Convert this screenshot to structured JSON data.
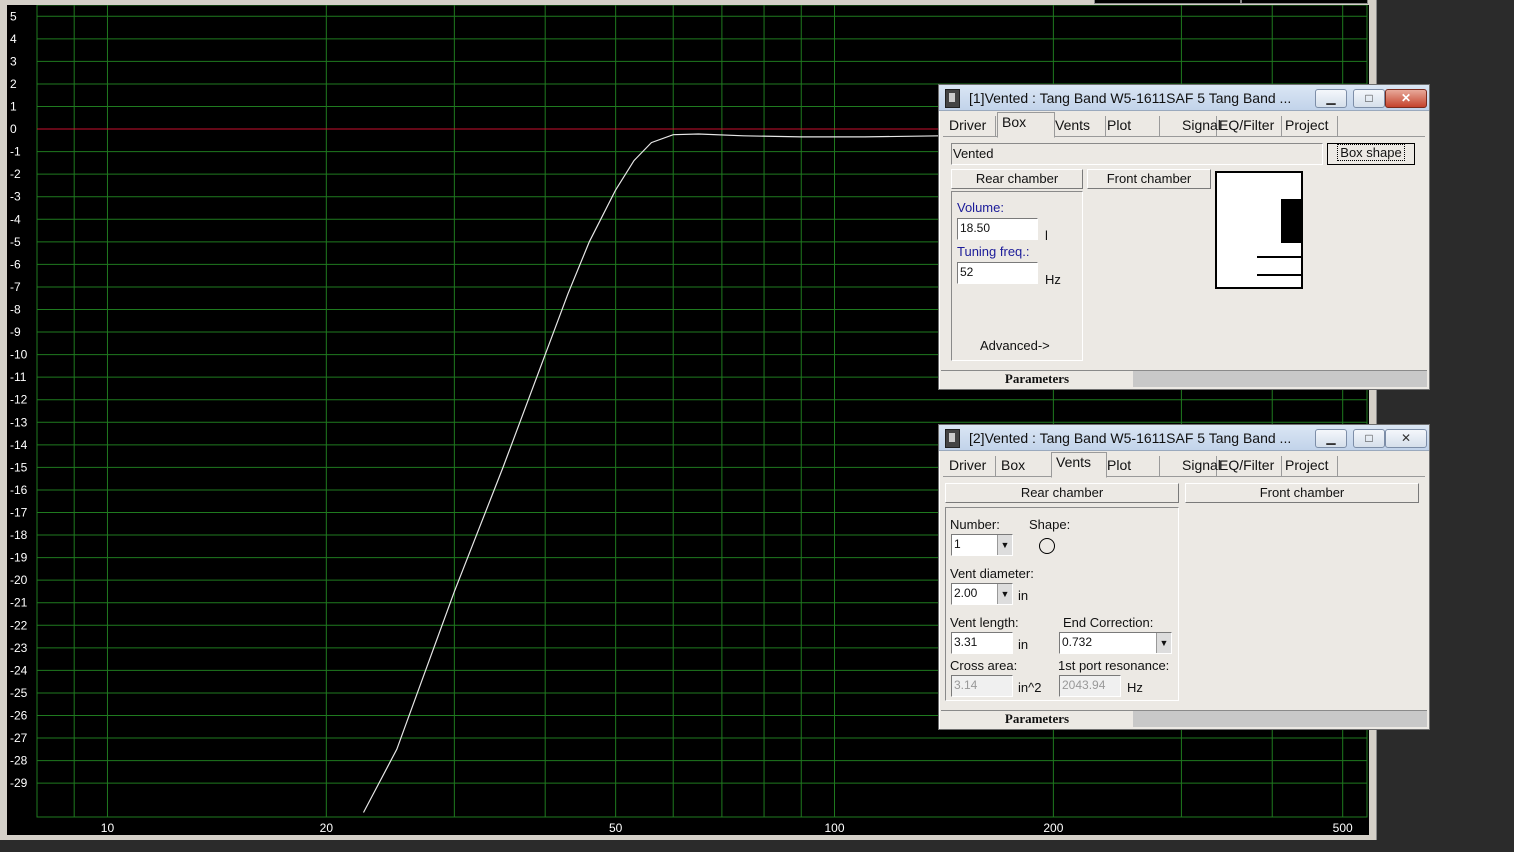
{
  "graph": {
    "chart_data": {
      "type": "line",
      "x_scale": "log",
      "xlim": [
        8,
        540
      ],
      "ylim": [
        -30.5,
        5.5
      ],
      "x_ticks": [
        10,
        20,
        50,
        100,
        200,
        500
      ],
      "x_tick_labels": [
        "10",
        "20",
        "50",
        "100",
        "200",
        "500"
      ],
      "y_ticks": [
        5,
        4,
        3,
        2,
        1,
        0,
        -1,
        -2,
        -3,
        -4,
        -5,
        -6,
        -7,
        -8,
        -9,
        -10,
        -11,
        -12,
        -13,
        -14,
        -15,
        -16,
        -17,
        -18,
        -19,
        -20,
        -21,
        -22,
        -23,
        -24,
        -25,
        -26,
        -27,
        -28,
        -29
      ],
      "grid": true,
      "reference_line_y": 0,
      "series": [
        {
          "color": "#e6e6e6",
          "x": [
            22.5,
            25,
            30,
            35,
            40,
            43,
            46,
            50,
            53,
            56,
            60,
            65,
            75,
            90,
            110,
            140,
            160
          ],
          "y": [
            -30.3,
            -27.5,
            -20.5,
            -15.0,
            -10.0,
            -7.3,
            -5.0,
            -2.7,
            -1.4,
            -0.6,
            -0.25,
            -0.22,
            -0.3,
            -0.35,
            -0.35,
            -0.3,
            -0.3
          ]
        }
      ],
      "colors": {
        "background": "#000000",
        "grid": "#1f7a1f",
        "reference": "#c8102e",
        "text": "#ffffff"
      }
    }
  },
  "win1": {
    "title": "[1]Vented : Tang Band W5-1611SAF 5 Tang Band ...",
    "tabs": [
      "Driver",
      "Box",
      "Vents",
      "Plot",
      "Signal",
      "EQ/Filter",
      "Project"
    ],
    "active_tab": "Box",
    "box_type": "Vented",
    "box_shape_button": "Box shape",
    "rear_chamber_button": "Rear chamber",
    "front_chamber_button": "Front chamber",
    "volume_label": "Volume:",
    "volume_value": "18.50",
    "volume_unit": "l",
    "tuning_label": "Tuning freq.:",
    "tuning_value": "52",
    "tuning_unit": "Hz",
    "advanced_button": "Advanced->",
    "status": "Parameters"
  },
  "win2": {
    "title": "[2]Vented : Tang Band W5-1611SAF 5 Tang Band ...",
    "tabs": [
      "Driver",
      "Box",
      "Vents",
      "Plot",
      "Signal",
      "EQ/Filter",
      "Project"
    ],
    "active_tab": "Vents",
    "rear_chamber_button": "Rear chamber",
    "front_chamber_button": "Front chamber",
    "number_label": "Number:",
    "number_value": "1",
    "shape_label": "Shape:",
    "vent_diameter_label": "Vent diameter:",
    "vent_diameter_value": "2.00",
    "vent_diameter_unit": "in",
    "vent_length_label": "Vent length:",
    "vent_length_value": "3.31",
    "vent_length_unit": "in",
    "end_correction_label": "End Correction:",
    "end_correction_value": "0.732",
    "cross_area_label": "Cross area:",
    "cross_area_value": "3.14",
    "cross_area_unit": "in^2",
    "port_resonance_label": "1st port resonance:",
    "port_resonance_value": "2043.94",
    "port_resonance_unit": "Hz",
    "status": "Parameters"
  }
}
